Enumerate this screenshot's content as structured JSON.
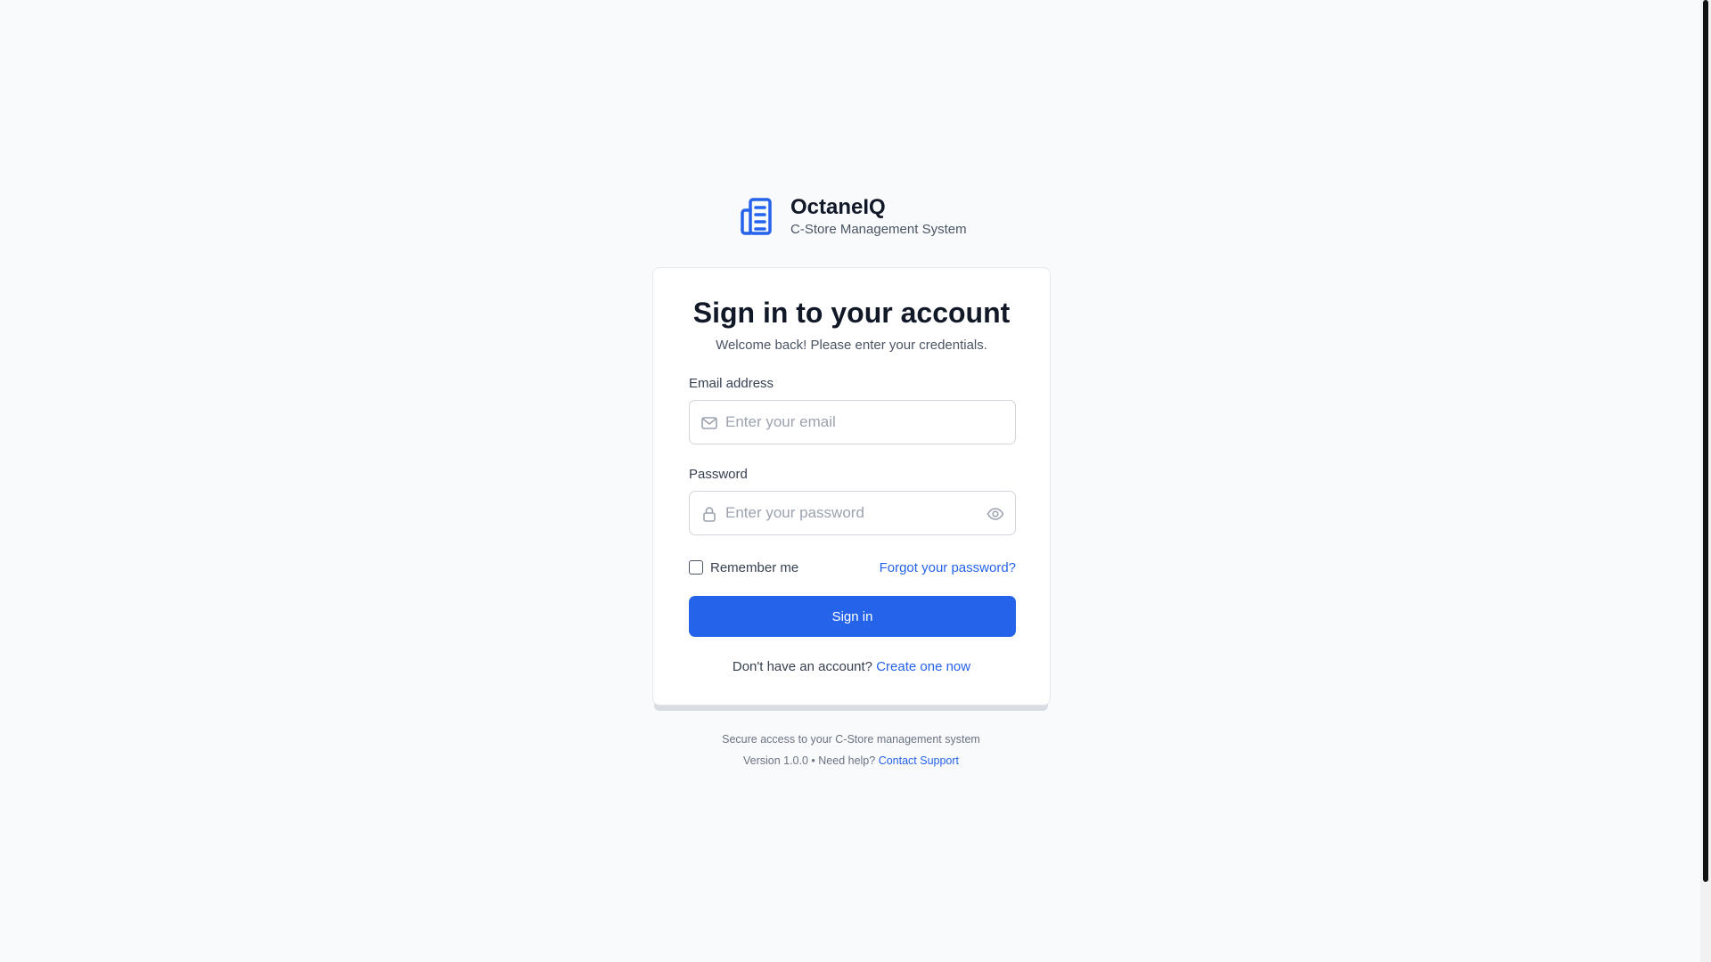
{
  "brand": {
    "name": "OctaneIQ",
    "tagline": "C-Store Management System",
    "icon": "building-icon"
  },
  "card": {
    "title": "Sign in to your account",
    "subtitle": "Welcome back! Please enter your credentials."
  },
  "email": {
    "label": "Email address",
    "placeholder": "Enter your email",
    "value": "",
    "icon": "mail-icon"
  },
  "password": {
    "label": "Password",
    "placeholder": "Enter your password",
    "value": "",
    "icon": "lock-icon",
    "toggle_icon": "eye-icon"
  },
  "remember": {
    "label": "Remember me",
    "checked": false
  },
  "forgot": {
    "label": "Forgot your password?"
  },
  "signin": {
    "label": "Sign in"
  },
  "signup": {
    "prompt": "Don't have an account?",
    "link": "Create one now"
  },
  "footer": {
    "secure_text": "Secure access to your C-Store management system",
    "version_text": "Version 1.0.0 • Need help?",
    "support_link": "Contact Support"
  },
  "colors": {
    "accent": "#2563eb",
    "background": "#f8fafc",
    "text": "#111827",
    "muted": "#6b7280"
  }
}
